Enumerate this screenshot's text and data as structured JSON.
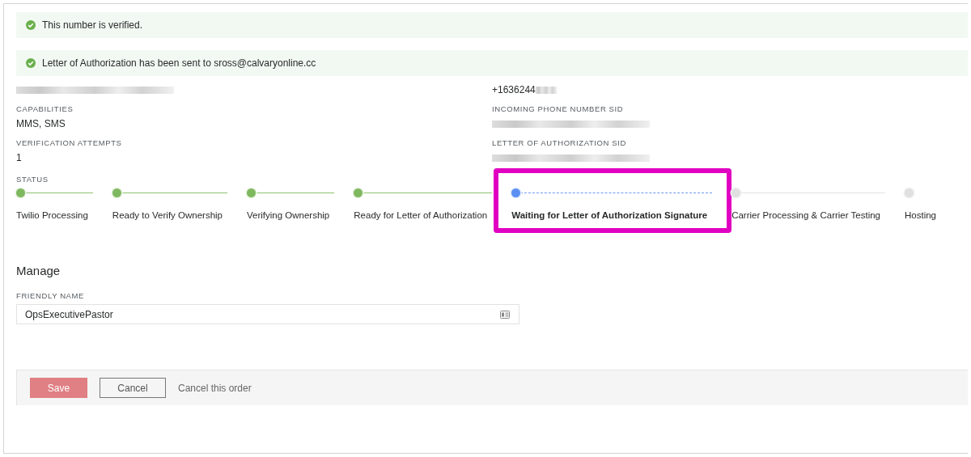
{
  "banners": [
    {
      "text": "This number is verified."
    },
    {
      "text": "Letter of Authorization has been sent to sross@calvaryonline.cc"
    }
  ],
  "properties": {
    "left": [
      {
        "redacted": true
      },
      {
        "label": "CAPABILITIES",
        "value": "MMS, SMS",
        "redacted": false
      },
      {
        "label": "VERIFICATION ATTEMPTS",
        "value": "1",
        "redacted": false
      }
    ],
    "right": [
      {
        "value": "+1636244",
        "redacted": true
      },
      {
        "label": "INCOMING PHONE NUMBER SID",
        "redacted": true
      },
      {
        "label": "LETTER OF AUTHORIZATION SID",
        "redacted": true
      }
    ]
  },
  "status": {
    "label": "STATUS",
    "steps": [
      {
        "label": "Twilio Processing",
        "done": true,
        "current": false,
        "highlighted": false
      },
      {
        "label": "Ready to Verify Ownership",
        "done": true,
        "current": false,
        "highlighted": false
      },
      {
        "label": "Verifying Ownership",
        "done": true,
        "current": false,
        "highlighted": false
      },
      {
        "label": "Ready for Letter of Authorization",
        "done": true,
        "current": false,
        "highlighted": false
      },
      {
        "label": "Waiting for Letter of Authorization Signature",
        "done": false,
        "current": true,
        "highlighted": true
      },
      {
        "label": "Carrier Processing & Carrier Testing",
        "done": false,
        "current": false,
        "highlighted": false
      },
      {
        "label": "Hosting",
        "done": false,
        "current": false,
        "highlighted": false
      }
    ]
  },
  "manage": {
    "heading": "Manage",
    "field_label": "FRIENDLY NAME",
    "field_value": "OpsExecutivePastor"
  },
  "footer": {
    "save": "Save",
    "cancel": "Cancel",
    "cancel_order": "Cancel this order"
  }
}
